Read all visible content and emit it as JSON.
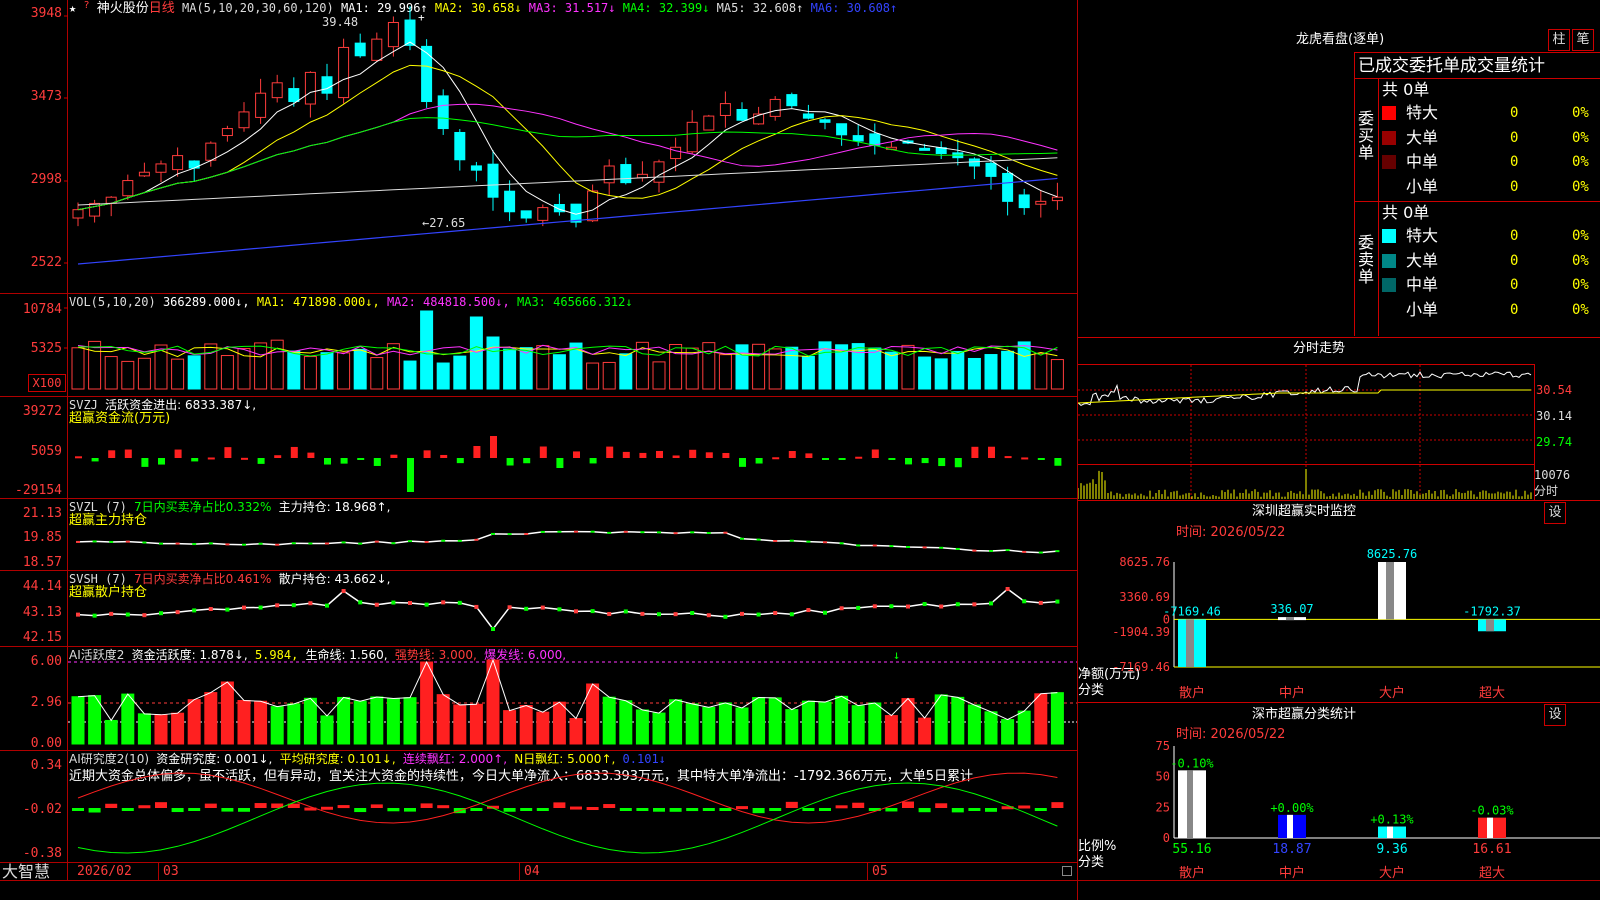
{
  "stock": {
    "star": "★",
    "q": "?",
    "name": "神火股份",
    "period": "日线",
    "ma_label": "MA(5,10,20,30,60,120)",
    "ma_values": [
      {
        "label": "MA1: 29.996↑",
        "color": "#ffffff"
      },
      {
        "label": "MA2: 30.658↓",
        "color": "#ffff00"
      },
      {
        "label": "MA3: 31.517↓",
        "color": "#ff33ff"
      },
      {
        "label": "MA4: 32.399↓",
        "color": "#00ff00"
      },
      {
        "label": "MA5: 32.608↑",
        "color": "#dddddd"
      },
      {
        "label": "MA6: 30.608↑",
        "color": "#3344ff"
      }
    ],
    "high_mark": "39.48",
    "low_mark": "←27.65",
    "price_axis": [
      "3948",
      "3473",
      "2998",
      "2522"
    ]
  },
  "volume": {
    "label": "VOL(5,10,20)",
    "value": "366289.000↓,",
    "ma1": "MA1: 471898.000↓,",
    "ma2": "MA2: 484818.500↓,",
    "ma3": "MA3: 465666.312↓",
    "axis": [
      "10784",
      "5325"
    ],
    "unit": "X100"
  },
  "svzj": {
    "label": "SVZJ",
    "text": "活跃资金进出: 6833.387↓,",
    "name": "超赢资金流(万元)",
    "axis": [
      "39272",
      "5059",
      "-29154"
    ]
  },
  "svzl": {
    "label": "SVZL (7)",
    "text1": "7日内买卖净占比0.332%",
    "text2": "主力持仓: 18.968↑,",
    "name": "超赢主力持仓",
    "axis": [
      "21.13",
      "19.85",
      "18.57"
    ]
  },
  "svsh": {
    "label": "SVSH (7)",
    "text1": "7日内买卖净占比0.461%",
    "text2": "散户持仓: 43.662↓,",
    "name": "超赢散户持仓",
    "axis": [
      "44.14",
      "43.13",
      "42.15"
    ]
  },
  "ai1": {
    "label": "AI活跃度2",
    "t1": "资金活跃度: 1.878↓,",
    "t2": "5.984,",
    "t3": "生命线: 1.560,",
    "t4": "强势线: 3.000,",
    "t5": "爆发线: 6.000,",
    "axis": [
      "6.00",
      "2.96",
      "0.00"
    ]
  },
  "ai2": {
    "label": "AI研究度2(10)",
    "t1": "资金研究度: 0.001↓,",
    "t2": "平均研究度: 0.101↓,",
    "t3": "连续飘红: 2.000↑,",
    "t4": "N日飘红: 5.000↑,",
    "t5": "0.101↓",
    "comment": "近期大资金总体偏多，虽不活跃，但有异动，宜关注大资金的持续性，今日大单净流入：6833.393万元，其中特大单净流出：-1792.366万元，大单5日累计",
    "axis": [
      "0.34",
      "-0.02",
      "-0.38"
    ]
  },
  "bottom": {
    "brand": "大智慧",
    "dates": [
      "2026/02",
      "03",
      "04",
      "05"
    ]
  },
  "longhu": {
    "title": "龙虎看盘(逐单)",
    "btn_col": "柱",
    "btn_pen": "笔",
    "subtitle": "已成交委托单成交量统计",
    "buy_label": "委买单",
    "sell_label": "委卖单",
    "buy_total": "共 0单",
    "sell_total": "共 0单",
    "buy_rows": [
      {
        "name": "特大",
        "count": "0",
        "pct": "0%",
        "color": "#ff0000"
      },
      {
        "name": "大单",
        "count": "0",
        "pct": "0%",
        "color": "#990000"
      },
      {
        "name": "中单",
        "count": "0",
        "pct": "0%",
        "color": "#660000"
      },
      {
        "name": "小单",
        "count": "0",
        "pct": "0%",
        "color": ""
      }
    ],
    "sell_rows": [
      {
        "name": "特大",
        "count": "0",
        "pct": "0%",
        "color": "#00ffff"
      },
      {
        "name": "大单",
        "count": "0",
        "pct": "0%",
        "color": "#008888"
      },
      {
        "name": "中单",
        "count": "0",
        "pct": "0%",
        "color": "#006666"
      },
      {
        "name": "小单",
        "count": "0",
        "pct": "0%",
        "color": ""
      }
    ]
  },
  "intraday": {
    "title": "分时走势",
    "axis": [
      "30.54",
      "30.14",
      "29.74"
    ],
    "vol_label": "10076",
    "vol_unit": "分时"
  },
  "monitor": {
    "title": "深圳超赢实时监控",
    "btn": "设",
    "time": "时间: 2026/05/22",
    "axis": [
      "8625.76",
      "3360.69",
      "0",
      "-1904.39",
      "-7169.46"
    ],
    "ylabel": "净额(万元)",
    "xlabel": "分类",
    "categories": [
      "散户",
      "中户",
      "大户",
      "超大"
    ],
    "values": [
      -7169.46,
      336.07,
      8625.76,
      -1792.37
    ],
    "value_labels": [
      "-7169.46",
      "336.07",
      "8625.76",
      "-1792.37"
    ]
  },
  "classify": {
    "title": "深市超赢分类统计",
    "btn": "设",
    "time": "时间: 2026/05/22",
    "axis": [
      "75",
      "50",
      "25",
      "0"
    ],
    "ylabel": "比例%",
    "xlabel": "分类",
    "categories": [
      "散户",
      "中户",
      "大户",
      "超大"
    ],
    "values": [
      55.16,
      18.87,
      9.36,
      16.61
    ],
    "value_labels": [
      "55.16",
      "18.87",
      "9.36",
      "16.61"
    ],
    "changes": [
      "-0.10%",
      "+0.00%",
      "+0.13%",
      "-0.03%"
    ]
  }
}
